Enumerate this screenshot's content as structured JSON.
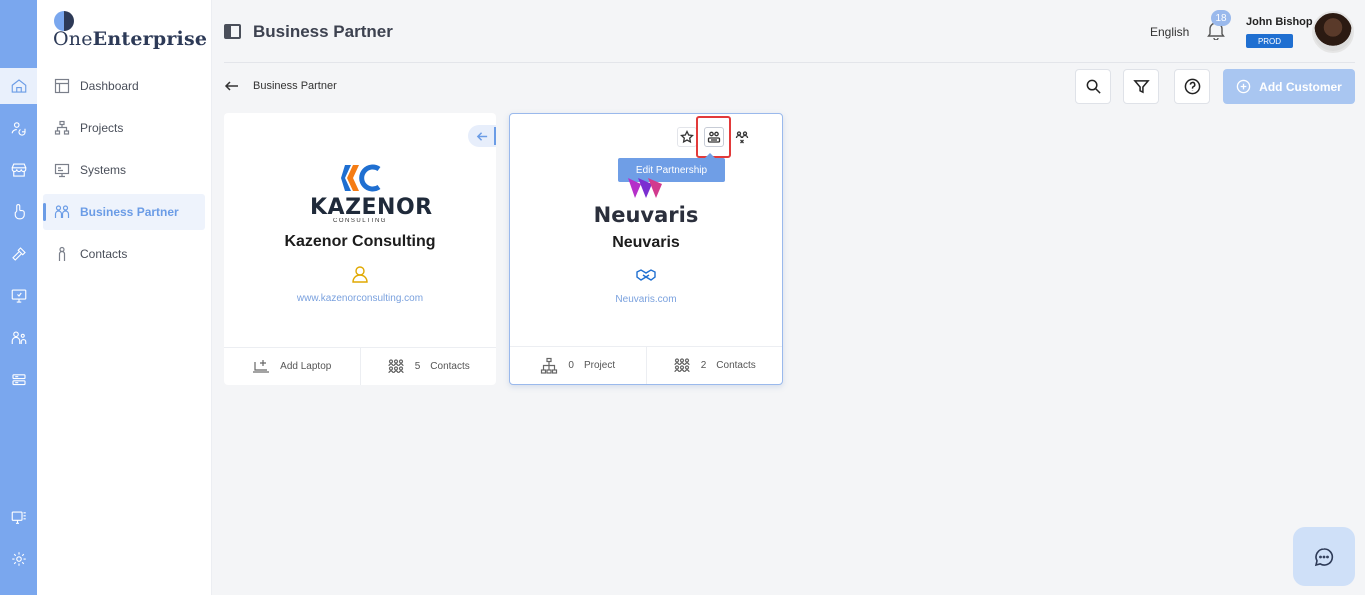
{
  "app": {
    "logo_part1": "One",
    "logo_part2": "Enterprise"
  },
  "rail": {
    "items": [
      {
        "icon": "home-icon",
        "active": true
      },
      {
        "icon": "users-sync-icon"
      },
      {
        "icon": "store-icon"
      },
      {
        "icon": "hand-pointer-icon"
      },
      {
        "icon": "hammer-icon"
      },
      {
        "icon": "monitor-settings-icon"
      },
      {
        "icon": "people-icon"
      },
      {
        "icon": "server-icon"
      }
    ],
    "bottom": [
      {
        "icon": "desktop-grid-icon"
      },
      {
        "icon": "settings-gear-icon"
      }
    ]
  },
  "sidebar": {
    "items": [
      {
        "label": "Dashboard",
        "icon": "dashboard-icon"
      },
      {
        "label": "Projects",
        "icon": "hierarchy-icon"
      },
      {
        "label": "Systems",
        "icon": "systems-icon"
      },
      {
        "label": "Business Partner",
        "icon": "partner-icon",
        "active": true
      },
      {
        "label": "Contacts",
        "icon": "person-icon"
      }
    ]
  },
  "header": {
    "title": "Business Partner",
    "language": "English",
    "notifications": "18",
    "user_name": "John Bishop",
    "environment": "PROD"
  },
  "toolbar": {
    "breadcrumb": "Business Partner",
    "add_label": "Add Customer"
  },
  "cards": [
    {
      "name": "Kazenor Consulting",
      "logo_word": "KAZENOR",
      "logo_sub": "CONSULTING",
      "url": "www.kazenorconsulting.com",
      "footer_left_label": "Add Laptop",
      "contacts_count": "5",
      "contacts_label": "Contacts",
      "role_color": "#e0a800"
    },
    {
      "name": "Neuvaris",
      "logo_word": "Neuvaris",
      "url": "Neuvaris.com",
      "projects_count": "0",
      "projects_label": "Project",
      "contacts_count": "2",
      "contacts_label": "Contacts",
      "tooltip": "Edit Partnership",
      "role_color": "#1f6fd1"
    }
  ],
  "colors": {
    "accent": "#6b9ce6",
    "rail": "#7aa7ee",
    "brand_dark": "#2d3a57"
  }
}
